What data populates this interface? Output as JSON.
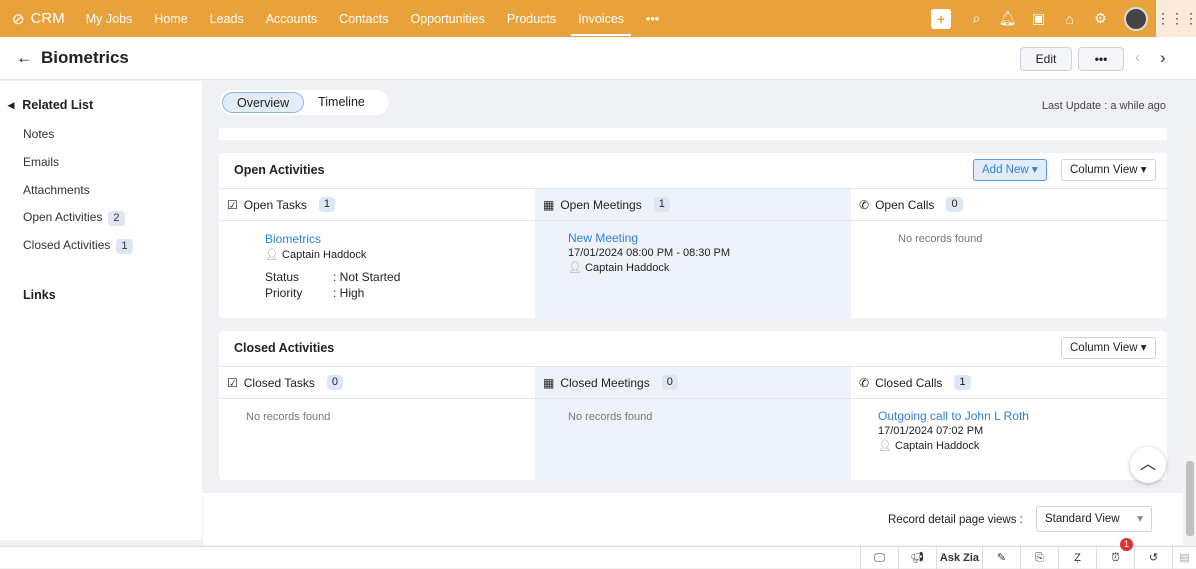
{
  "app": {
    "name": "CRM",
    "nav": [
      "My Jobs",
      "Home",
      "Leads",
      "Accounts",
      "Contacts",
      "Opportunities",
      "Products",
      "Invoices"
    ],
    "active": "Invoices",
    "more": "•••"
  },
  "header": {
    "title": "Biometrics",
    "edit": "Edit",
    "more": "•••"
  },
  "sidebar": {
    "related": "Related List",
    "items": [
      {
        "label": "Notes"
      },
      {
        "label": "Emails"
      },
      {
        "label": "Attachments"
      },
      {
        "label": "Open Activities",
        "count": "2"
      },
      {
        "label": "Closed Activities",
        "count": "1"
      }
    ],
    "links": "Links"
  },
  "tabs": {
    "overview": "Overview",
    "timeline": "Timeline"
  },
  "last_update": "Last Update : a while ago",
  "open": {
    "title": "Open Activities",
    "add_new": "Add New",
    "view": "Column View",
    "tasks": {
      "label": "Open Tasks",
      "count": "1",
      "item": {
        "title": "Biometrics",
        "owner": "Captain Haddock",
        "status_label": "Status",
        "status": ": Not Started",
        "priority_label": "Priority",
        "priority": ": High"
      }
    },
    "meetings": {
      "label": "Open Meetings",
      "count": "1",
      "item": {
        "title": "New Meeting",
        "time": "17/01/2024 08:00 PM - 08:30 PM",
        "owner": "Captain Haddock"
      }
    },
    "calls": {
      "label": "Open Calls",
      "count": "0",
      "empty": "No records found"
    }
  },
  "closed": {
    "title": "Closed Activities",
    "view": "Column View",
    "tasks": {
      "label": "Closed Tasks",
      "count": "0",
      "empty": "No records found"
    },
    "meetings": {
      "label": "Closed Meetings",
      "count": "0",
      "empty": "No records found"
    },
    "calls": {
      "label": "Closed Calls",
      "count": "1",
      "item": {
        "title": "Outgoing call to John L Roth",
        "time": "17/01/2024 07:02 PM",
        "owner": "Captain Haddock"
      }
    }
  },
  "footer": {
    "label": "Record detail page views :",
    "view": "Standard View"
  },
  "bottom": {
    "ask_zia": "Ask Zia",
    "alarm_badge": "1"
  }
}
